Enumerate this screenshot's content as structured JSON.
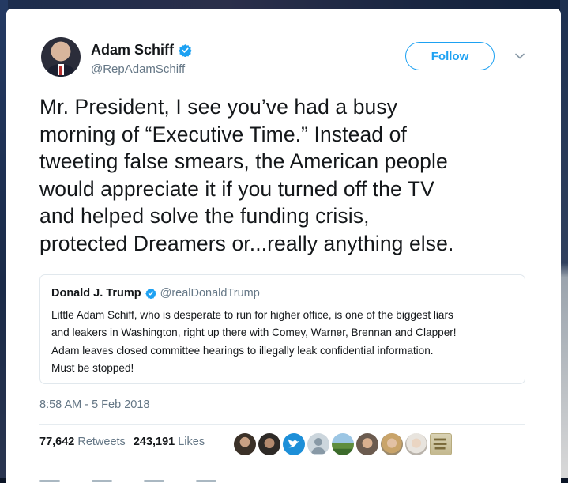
{
  "tweet": {
    "author": {
      "display_name": "Adam Schiff",
      "handle": "@RepAdamSchiff",
      "verified": true,
      "avatar_icon": "avatar-photo-icon"
    },
    "follow_button_label": "Follow",
    "text_lines": [
      "Mr. President, I see you’ve had a busy",
      "morning of “Executive Time.” Instead of",
      "tweeting false smears, the American people",
      "would appreciate it if you turned off the TV",
      "and helped solve the funding crisis,",
      "protected Dreamers or...really anything else."
    ],
    "quoted_tweet": {
      "display_name": "Donald J. Trump",
      "handle": "@realDonaldTrump",
      "verified": true,
      "text_lines": [
        "Little Adam Schiff, who is desperate to run for higher office, is one of the biggest liars",
        "and leakers in Washington, right up there with Comey, Warner, Brennan and Clapper!",
        "Adam leaves closed committee hearings to illegally leak confidential information.",
        "Must be stopped!"
      ]
    },
    "timestamp": "8:58 AM - 5 Feb 2018",
    "stats": {
      "retweets_count": "77,642",
      "retweets_label": "Retweets",
      "likes_count": "243,191",
      "likes_label": "Likes"
    },
    "liker_avatars": [
      "liker-avatar-1",
      "liker-avatar-2",
      "liker-avatar-3",
      "liker-avatar-4",
      "liker-avatar-5",
      "liker-avatar-6",
      "liker-avatar-7",
      "liker-avatar-8",
      "liker-avatar-9"
    ],
    "colors": {
      "accent": "#1da1f2",
      "text": "#14171a",
      "secondary_text": "#657786",
      "border": "#e1e8ed"
    }
  }
}
